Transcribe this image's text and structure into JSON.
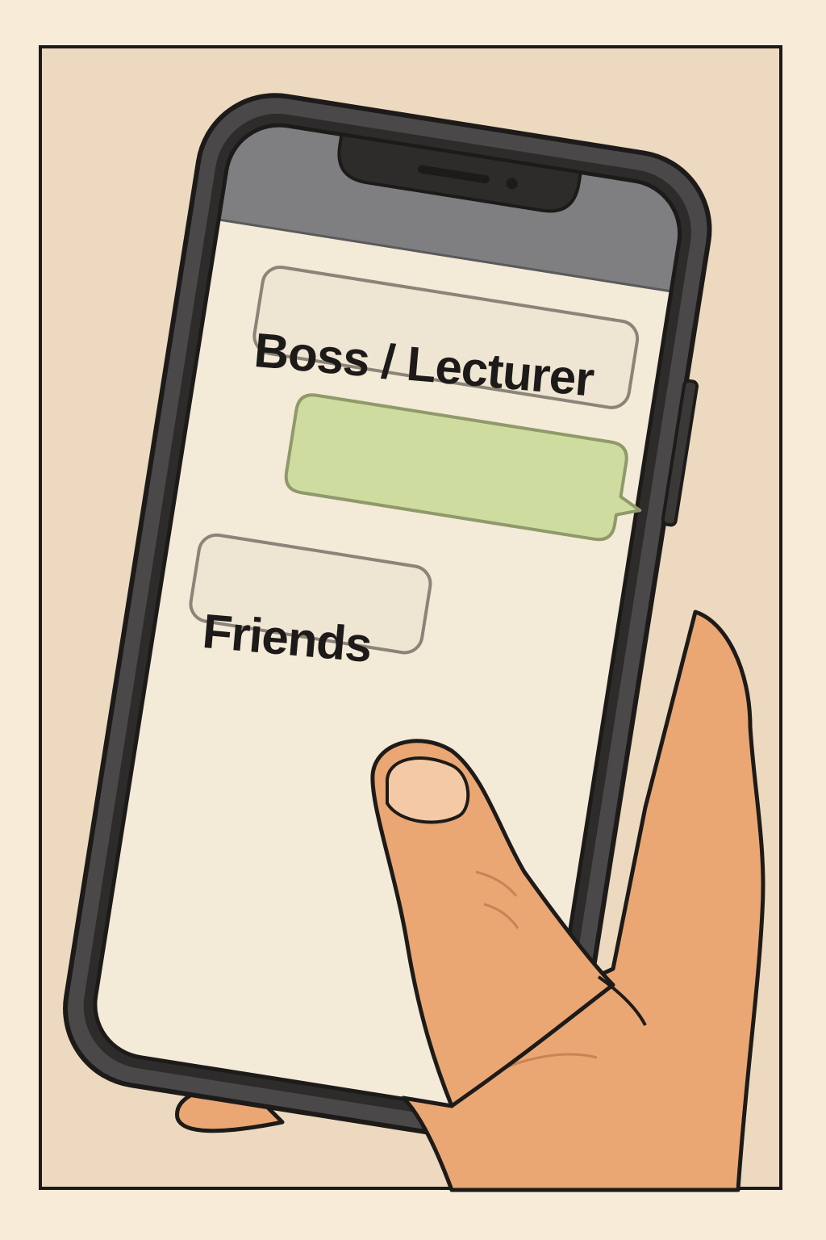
{
  "chat": {
    "items": [
      {
        "label": "Boss / Lecturer"
      },
      {
        "label": ""
      },
      {
        "label": "Friends"
      }
    ]
  },
  "colors": {
    "background": "#edd9bf",
    "screen": "#f4ead8",
    "status_bar": "#7f7f82",
    "phone_body": "#4a4848",
    "outgoing_bubble": "#cfdca0",
    "skin": "#eaa773",
    "outline": "#1d1b19"
  }
}
